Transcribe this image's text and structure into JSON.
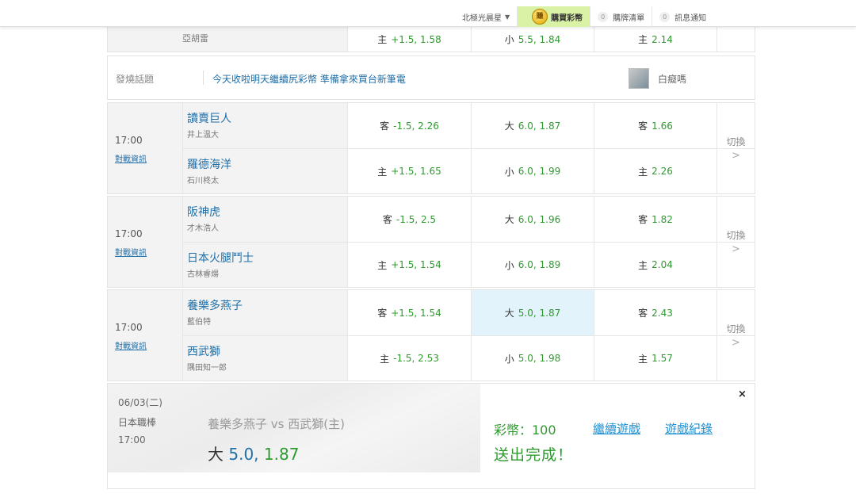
{
  "topbar": {
    "user": "北極光晨星",
    "buy_coin_icon": "賺",
    "buy_label": "購買彩幣",
    "cart_count": "0",
    "cart_label": "購牌清單",
    "notice_count": "0",
    "notice_label": "訊息通知"
  },
  "partial_top": {
    "pitcher": "亞胡雷",
    "spread": {
      "side": "主",
      "odds": "+1.5, 1.58"
    },
    "total": {
      "side": "小",
      "odds": "5.5, 1.84"
    },
    "moneyline": {
      "side": "主",
      "odds": "2.14"
    }
  },
  "topic": {
    "label": "發燒話題",
    "text": "今天收啦明天繼續尻彩幣 準備拿來買台新筆電",
    "user": "白癡嗎"
  },
  "games": [
    {
      "time": "17:00",
      "info": "對戰資訊",
      "switch": "切換",
      "away": {
        "team": "讀賣巨人",
        "pitcher": "井上温大",
        "spread": {
          "side": "客",
          "odds": "-1.5, 2.26"
        },
        "total": {
          "side": "大",
          "odds": "6.0, 1.87"
        },
        "ml": {
          "side": "客",
          "odds": "1.66"
        }
      },
      "home": {
        "team": "羅德海洋",
        "pitcher": "石川柊太",
        "spread": {
          "side": "主",
          "odds": "+1.5, 1.65"
        },
        "total": {
          "side": "小",
          "odds": "6.0, 1.99"
        },
        "ml": {
          "side": "主",
          "odds": "2.26"
        }
      }
    },
    {
      "time": "17:00",
      "info": "對戰資訊",
      "switch": "切換",
      "away": {
        "team": "阪神虎",
        "pitcher": "才木浩人",
        "spread": {
          "side": "客",
          "odds": "-1.5, 2.5"
        },
        "total": {
          "side": "大",
          "odds": "6.0, 1.96"
        },
        "ml": {
          "side": "客",
          "odds": "1.82"
        }
      },
      "home": {
        "team": "日本火腿鬥士",
        "pitcher": "古林睿煬",
        "spread": {
          "side": "主",
          "odds": "+1.5, 1.54"
        },
        "total": {
          "side": "小",
          "odds": "6.0, 1.89"
        },
        "ml": {
          "side": "主",
          "odds": "2.04"
        }
      }
    },
    {
      "time": "17:00",
      "info": "對戰資訊",
      "switch": "切換",
      "away": {
        "team": "養樂多燕子",
        "pitcher": "藍伯特",
        "spread": {
          "side": "客",
          "odds": "+1.5, 1.54"
        },
        "total": {
          "side": "大",
          "odds": "5.0, 1.87"
        },
        "ml": {
          "side": "客",
          "odds": "2.43"
        }
      },
      "home": {
        "team": "西武獅",
        "pitcher": "隅田知一郎",
        "spread": {
          "side": "主",
          "odds": "-1.5, 2.53"
        },
        "total": {
          "side": "小",
          "odds": "5.0, 1.98"
        },
        "ml": {
          "side": "主",
          "odds": "1.57"
        }
      }
    }
  ],
  "confirm": {
    "date": "06/03(二)",
    "league": "日本職棒",
    "time": "17:00",
    "matchup": "養樂多燕子 vs 西武獅(主)",
    "bet_side": "大",
    "bet_line": "5.0,",
    "bet_odds": "1.87",
    "coins": "彩幣：100",
    "status": "送出完成！",
    "continue_link": "繼續遊戲",
    "history_link": "遊戲紀錄",
    "close": "×"
  }
}
